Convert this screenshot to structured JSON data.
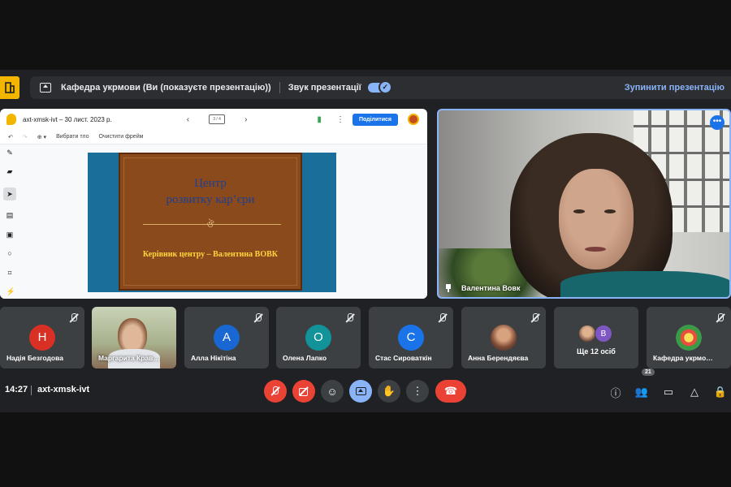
{
  "banner": {
    "title": "Кафедра укрмови (Ви (показуєте презентацію))",
    "sound_label": "Звук презентації",
    "stop_label": "Зупинити презентацію"
  },
  "jam": {
    "title": "axt-xmsk-ivt – 30 лист. 2023 р.",
    "page_indicator": "3 / 4",
    "share_label": "Поділитися",
    "set_background": "Вибрати тло",
    "clear_frame": "Очистити фрейм"
  },
  "slide": {
    "line1": "Центр",
    "line2": "розвитку кар’єри",
    "ornament": "ঔ",
    "subtitle": "Керівник центру – Валентина ВОВК"
  },
  "speaker": {
    "name": "Валентина Вовк"
  },
  "participants": [
    {
      "name": "Надія Безгодова",
      "initial": "Н",
      "color": "#d93025"
    },
    {
      "name": "Маргарита Крав…",
      "initial": "",
      "color": ""
    },
    {
      "name": "Алла Нікітіна",
      "initial": "А",
      "color": "#1967d2"
    },
    {
      "name": "Олена Лапко",
      "initial": "О",
      "color": "#12939a"
    },
    {
      "name": "Стас Сироваткін",
      "initial": "С",
      "color": "#1a73e8"
    },
    {
      "name": "Анна Берендяєва",
      "initial": "",
      "color": ""
    },
    {
      "name": "Ще 12 осіб",
      "initial": "В",
      "color": "#7e57c2"
    },
    {
      "name": "Кафедра укрмо…",
      "initial": "",
      "color": ""
    }
  ],
  "footer": {
    "time": "14:27",
    "meeting_code": "axt-xmsk-ivt",
    "participant_count": "21"
  }
}
